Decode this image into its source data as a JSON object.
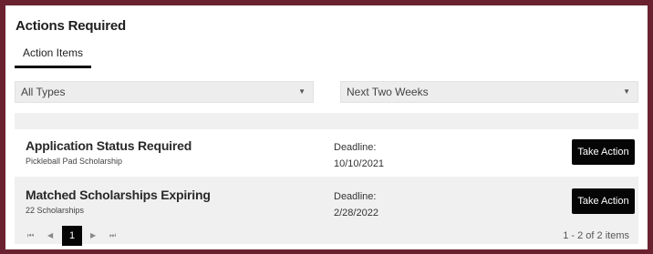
{
  "header": {
    "title": "Actions Required"
  },
  "tabs": [
    {
      "label": "Action Items",
      "active": true
    }
  ],
  "filters": {
    "type": {
      "selected": "All Types",
      "arrow": "▼"
    },
    "range": {
      "selected": "Next Two Weeks",
      "arrow": "▼"
    }
  },
  "items": [
    {
      "name": "Application Status Required",
      "subtitle": "Pickleball Pad Scholarship",
      "deadline_label": "Deadline:",
      "deadline": "10/10/2021",
      "action_label": "Take Action"
    },
    {
      "name": "Matched Scholarships Expiring",
      "subtitle": "22 Scholarships",
      "deadline_label": "Deadline:",
      "deadline": "2/28/2022",
      "action_label": "Take Action"
    }
  ],
  "pagination": {
    "first": "⏮",
    "prev": "◀",
    "current_page": "1",
    "next": "▶",
    "last": "⏭",
    "summary": "1 - 2 of 2 items"
  },
  "colors": {
    "frame": "#6b2230",
    "button": "#050505",
    "filter_bg": "#ededed"
  }
}
